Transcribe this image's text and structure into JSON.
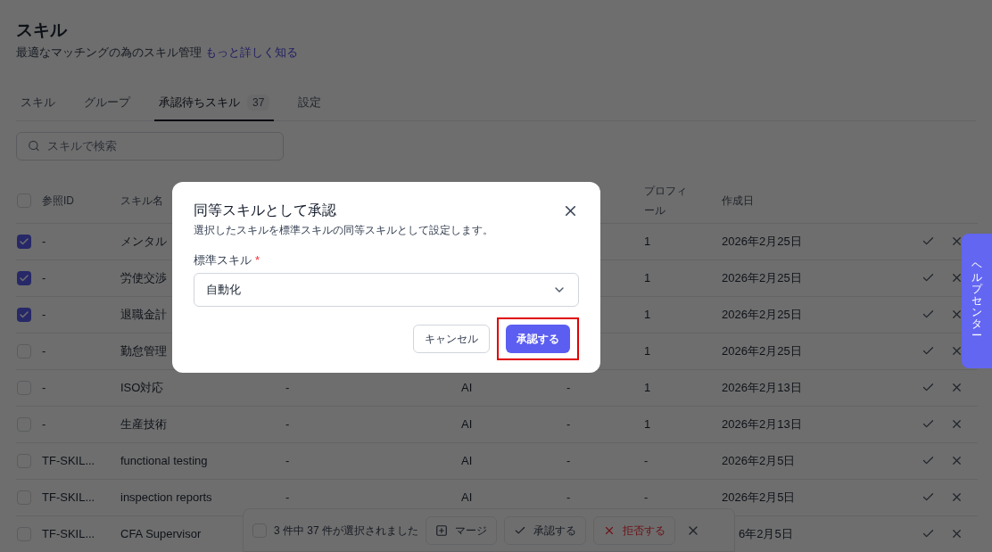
{
  "page": {
    "title": "スキル",
    "subtitle": "最適なマッチングの為のスキル管理",
    "learn_more_link": "もっと詳しく知る"
  },
  "tabs": [
    {
      "label": "スキル",
      "selected": false
    },
    {
      "label": "グループ",
      "selected": false
    },
    {
      "label": "承認待ちスキル",
      "badge": "37",
      "selected": true
    },
    {
      "label": "設定",
      "selected": false
    }
  ],
  "search": {
    "placeholder": "スキルで検索"
  },
  "table": {
    "select_all_checked": false,
    "columns": [
      {
        "label": "参照ID"
      },
      {
        "label": "スキル名"
      },
      {},
      {},
      {},
      {
        "label": "プロフィール"
      },
      {
        "label": "作成日"
      }
    ],
    "rows": [
      {
        "selected": true,
        "cells": [
          "-",
          "メンタル",
          "",
          "",
          "",
          "1",
          "2026年2月25日"
        ]
      },
      {
        "selected": true,
        "cells": [
          "-",
          "労使交渉",
          "",
          "",
          "",
          "1",
          "2026年2月25日"
        ]
      },
      {
        "selected": true,
        "cells": [
          "-",
          "退職金計",
          "",
          "",
          "",
          "1",
          "2026年2月25日"
        ]
      },
      {
        "selected": false,
        "cells": [
          "-",
          "勤怠管理",
          "",
          "",
          "",
          "1",
          "2026年2月25日"
        ]
      },
      {
        "selected": false,
        "cells": [
          "-",
          "ISO対応",
          "-",
          "AI",
          "-",
          "1",
          "2026年2月13日"
        ]
      },
      {
        "selected": false,
        "cells": [
          "-",
          "生産技術",
          "-",
          "AI",
          "-",
          "1",
          "2026年2月13日"
        ]
      },
      {
        "selected": false,
        "cells": [
          "TF-SKIL...",
          "functional testing",
          "-",
          "AI",
          "-",
          "-",
          "2026年2月5日"
        ]
      },
      {
        "selected": false,
        "cells": [
          "TF-SKIL...",
          "inspection reports",
          "-",
          "AI",
          "-",
          "-",
          "2026年2月5日"
        ]
      },
      {
        "selected": false,
        "cells": [
          "TF-SKIL...",
          "CFA Supervisor",
          "",
          "",
          "",
          "",
          "6年2月5日"
        ]
      }
    ]
  },
  "bulk_bar": {
    "checked": false,
    "selection_text": "3 件中 37 件が選択されました",
    "actions": [
      {
        "kind": "merge",
        "label": "マージ"
      },
      {
        "kind": "approve",
        "label": "承認する"
      },
      {
        "kind": "reject",
        "label": "拒否する"
      }
    ]
  },
  "dialog": {
    "title": "同等スキルとして承認",
    "description": "選択したスキルを標準スキルの同等スキルとして設定します。",
    "field_label": "標準スキル",
    "required_mark": "*",
    "field_value": "自動化",
    "cancel": "キャンセル",
    "confirm": "承認する",
    "confirm_highlighted": true
  },
  "help_tab": {
    "label": "ヘルプセンター"
  }
}
